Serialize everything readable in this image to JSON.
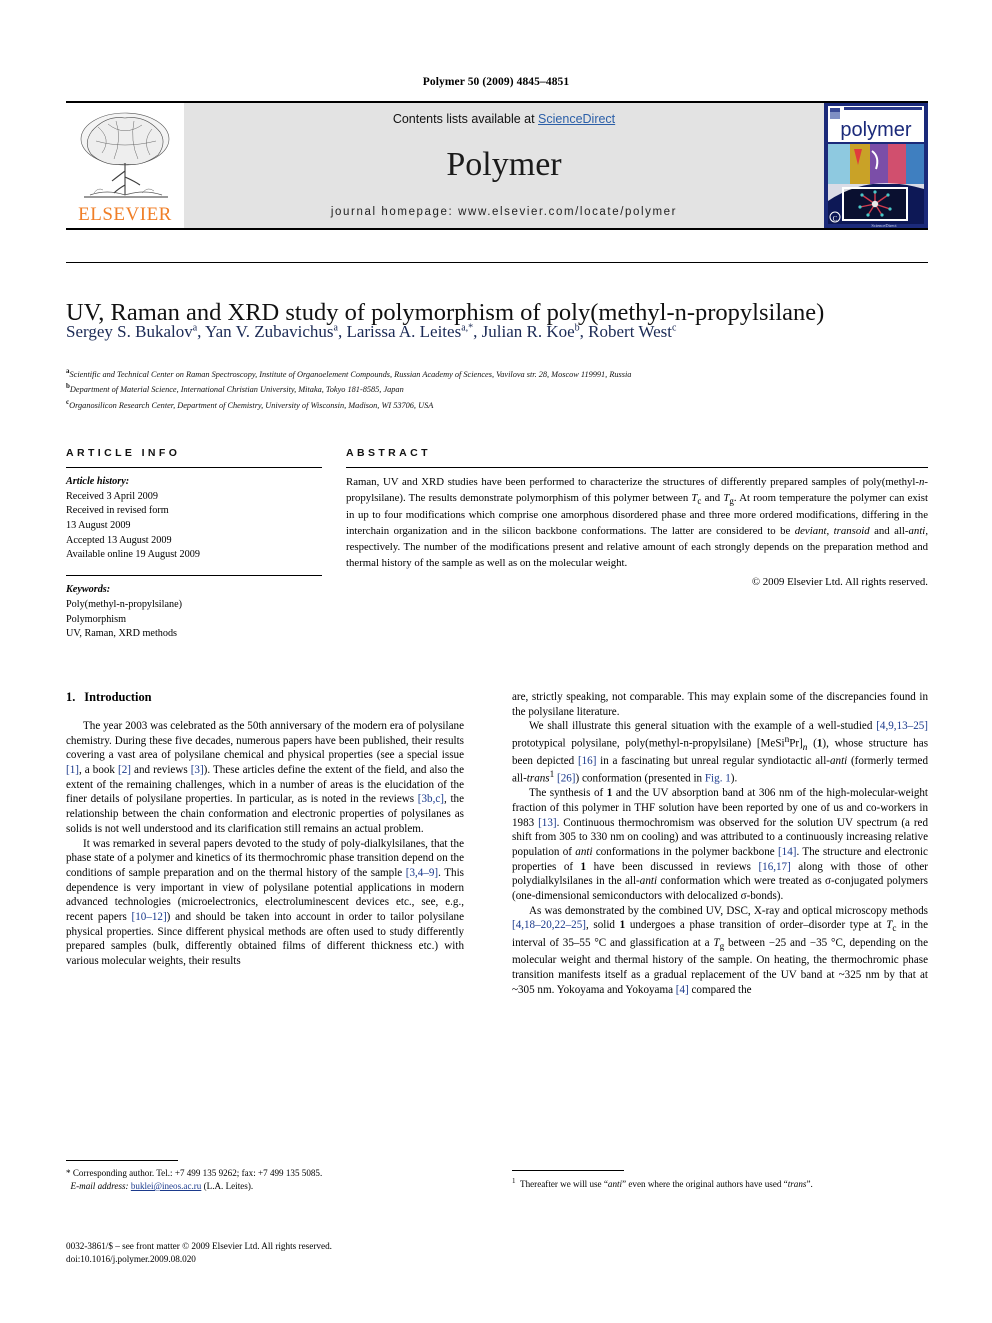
{
  "running_head": "Polymer 50 (2009) 4845–4851",
  "masthead": {
    "contents_prefix": "Contents lists available at ",
    "sciencedirect": "ScienceDirect",
    "journal_title": "Polymer",
    "homepage": "journal homepage: www.elsevier.com/locate/polymer",
    "publisher_wordmark": "ELSEVIER",
    "cover_wordmark": "polymer",
    "brand_orange": "#F07E26",
    "link_blue": "#2b5fa8",
    "cover_blue": "#1b2a7a"
  },
  "article": {
    "title": "UV, Raman and XRD study of polymorphism of poly(methyl-n-propylsilane)",
    "authors_html": "Sergey S. Bukalov<sup>a</sup>, Yan V. Zubavichus<sup>a</sup>, Larissa A. Leites<sup>a,*</sup>, Julian R. Koe<sup>b</sup>, Robert West<sup>c</sup>",
    "affiliations": [
      {
        "marker": "a",
        "text": "Scientific and Technical Center on Raman Spectroscopy, Institute of Organoelement Compounds, Russian Academy of Sciences, Vavilova str. 28, Moscow 119991, Russia"
      },
      {
        "marker": "b",
        "text": "Department of Material Science, International Christian University, Mitaka, Tokyo 181-8585, Japan"
      },
      {
        "marker": "c",
        "text": "Organosilicon Research Center, Department of Chemistry, University of Wisconsin, Madison, WI 53706, USA"
      }
    ]
  },
  "article_info": {
    "heading": "ARTICLE INFO",
    "history_label": "Article history:",
    "history": [
      "Received 3 April 2009",
      "Received in revised form",
      "13 August 2009",
      "Accepted 13 August 2009",
      "Available online 19 August 2009"
    ],
    "keywords_label": "Keywords:",
    "keywords": [
      "Poly(methyl-n-propylsilane)",
      "Polymorphism",
      "UV, Raman, XRD methods"
    ]
  },
  "abstract": {
    "heading": "ABSTRACT",
    "paragraph_html": "Raman, UV and XRD studies have been performed to characterize the structures of differently prepared samples of poly(methyl-<i>n</i>-propylsilane). The results demonstrate polymorphism of this polymer between <i>T</i><sub>c</sub> and <i>T</i><sub>g</sub>. At room temperature the polymer can exist in up to four modifications which comprise one amorphous disordered phase and three more ordered modifications, differing in the interchain organization and in the silicon backbone conformations. The latter are considered to be <i>deviant</i>, <i>transoid</i> and all-<i>anti</i>, respectively. The number of the modifications present and relative amount of each strongly depends on the preparation method and thermal history of the sample as well as on the molecular weight.",
    "copyright": "© 2009 Elsevier Ltd. All rights reserved."
  },
  "sections": {
    "intro_number": "1.",
    "intro_title": "Introduction"
  },
  "body_left": [
    "The year 2003 was celebrated as the 50th anniversary of the modern era of polysilane chemistry. During these five decades, numerous papers have been published, their results covering a vast area of polysilane chemical and physical properties (see a special issue <span class=\"ref\">[1]</span>, a book <span class=\"ref\">[2]</span> and reviews <span class=\"ref\">[3]</span>). These articles define the extent of the field, and also the extent of the remaining challenges, which in a number of areas is the elucidation of the finer details of polysilane properties. In particular, as is noted in the reviews <span class=\"ref\">[3b,c]</span>, the relationship between the chain conformation and electronic properties of polysilanes as solids is not well understood and its clarification still remains an actual problem.",
    "It was remarked in several papers devoted to the study of poly-dialkylsilanes, that the phase state of a polymer and kinetics of its thermochromic phase transition depend on the conditions of sample preparation and on the thermal history of the sample <span class=\"ref\">[3,4&ndash;9]</span>. This dependence is very important in view of polysilane potential applications in modern advanced technologies (microelectronics, electroluminescent devices etc., see, e.g., recent papers <span class=\"ref\">[10&ndash;12]</span>) and should be taken into account in order to tailor polysilane physical properties. Since different physical methods are often used to study differently prepared samples (bulk, differently obtained films of different thickness etc.) with various molecular weights, their results"
  ],
  "body_right": [
    "are, strictly speaking, not comparable. This may explain some of the discrepancies found in the polysilane literature.",
    "We shall illustrate this general situation with the example of a well-studied <span class=\"ref\">[4,9,13&ndash;25]</span> prototypical polysilane, poly(methyl-n-propylsilane) [MeSi<sup>n</sup>Pr]<sub><i>n</i></sub> (<b>1</b>), whose structure has been depicted <span class=\"ref\">[16]</span> in a fascinating but unreal regular syndiotactic all-<i>anti</i> (formerly termed all-<i>trans</i><sup>1</sup> <span class=\"ref\">[26]</span>) conformation (presented in <span class=\"ref\">Fig. 1</span>).",
    "The synthesis of <b>1</b> and the UV absorption band at 306 nm of the high-molecular-weight fraction of this polymer in THF solution have been reported by one of us and co-workers in 1983 <span class=\"ref\">[13]</span>. Continuous thermochromism was observed for the solution UV spectrum (a red shift from 305 to 330 nm on cooling) and was attributed to a continuously increasing relative population of <i>anti</i> conformations in the polymer backbone <span class=\"ref\">[14]</span>. The structure and electronic properties of <b>1</b> have been discussed in reviews <span class=\"ref\">[16,17]</span> along with those of other polydialkylsilanes in the all-<i>anti</i> conformation which were treated as σ-conjugated polymers (one-dimensional semiconductors with delocalized σ-bonds).",
    "As was demonstrated by the combined UV, DSC, X-ray and optical microscopy methods <span class=\"ref\">[4,18&ndash;20,22&ndash;25]</span>, solid <b>1</b> undergoes a phase transition of order&ndash;disorder type at <i>T</i><sub>c</sub> in the interval of 35&ndash;55 &deg;C and glassification at a <i>T</i><sub>g</sub> between &minus;25 and &minus;35 &deg;C, depending on the molecular weight and thermal history of the sample. On heating, the thermochromic phase transition manifests itself as a gradual replacement of the UV band at ~325 nm by that at ~305 nm. Yokoyama and Yokoyama <span class=\"ref\">[4]</span> compared the"
  ],
  "footnotes": {
    "corresponding_html": "* Corresponding author. Tel.: +7 499 135 9262; fax: +7 499 135 5085.",
    "email_label": "E-mail address:",
    "email": "buklei@ineos.ac.ru",
    "email_owner": "(L.A. Leites).",
    "footnote1_html": "<sup>1</sup>&nbsp;&nbsp;Thereafter we will use “<i>anti</i>” even where the original authors have used “<i>trans</i>”."
  },
  "imprint": {
    "line1": "0032-3861/$ – see front matter © 2009 Elsevier Ltd. All rights reserved.",
    "line2": "doi:10.1016/j.polymer.2009.08.020"
  }
}
